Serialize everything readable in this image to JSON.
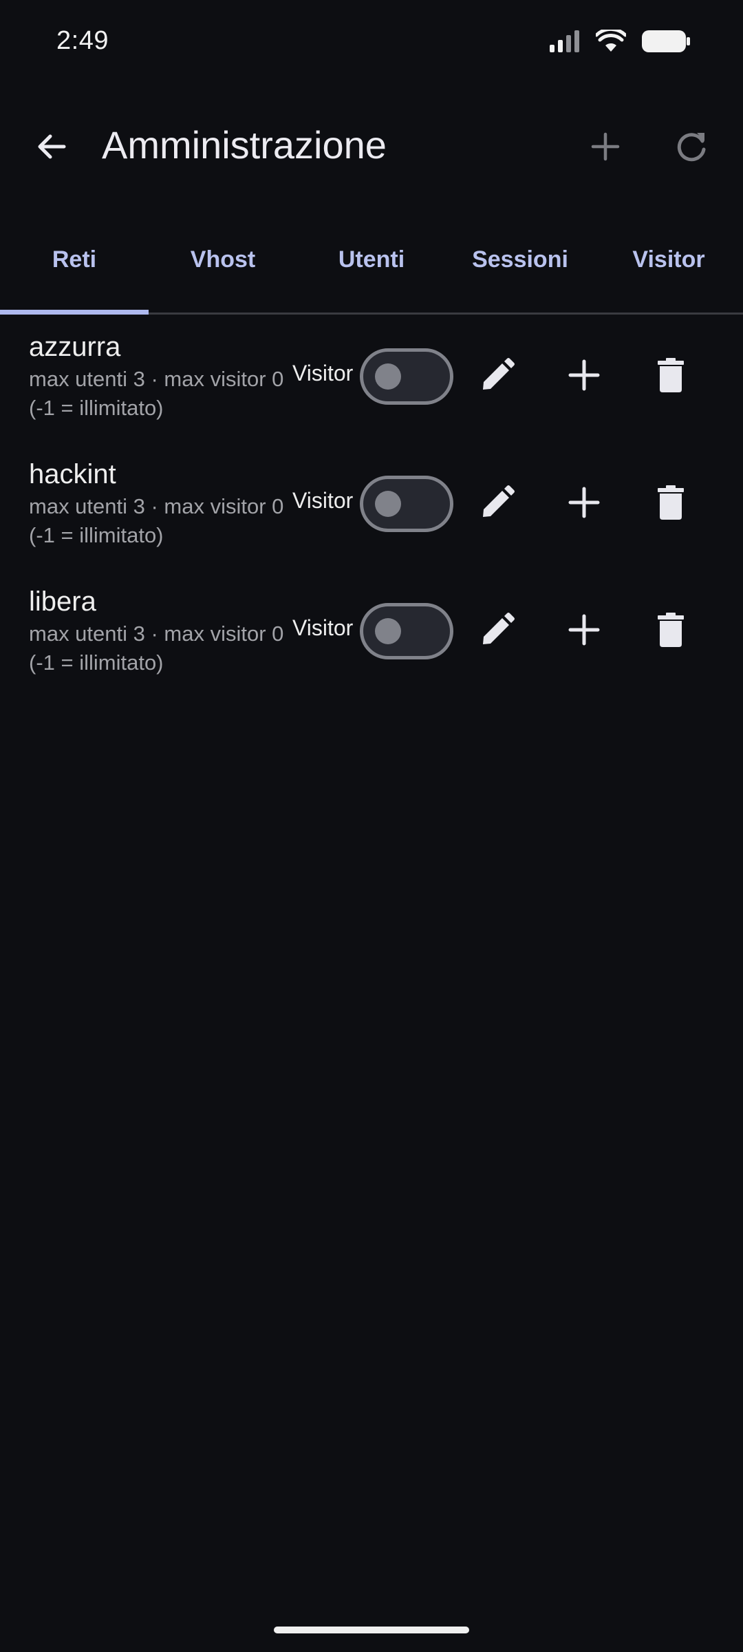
{
  "status_bar": {
    "time": "2:49",
    "icons": [
      "cellular-signal-icon",
      "wifi-icon",
      "battery-icon"
    ]
  },
  "app_bar": {
    "title": "Amministrazione",
    "back_icon": "arrow-left-icon",
    "actions": [
      "plus-icon",
      "refresh-icon"
    ]
  },
  "tabs": [
    {
      "label": "Reti",
      "active": true
    },
    {
      "label": "Vhost",
      "active": false
    },
    {
      "label": "Utenti",
      "active": false
    },
    {
      "label": "Sessioni",
      "active": false
    },
    {
      "label": "Visitor",
      "active": false
    }
  ],
  "networks": [
    {
      "name": "azzurra",
      "meta": "max utenti 3 · max visitor 0 (-1 = illimitato)",
      "visitor_label": "Visitor",
      "visitor_enabled": false
    },
    {
      "name": "hackint",
      "meta": "max utenti 3 · max visitor 0 (-1 = illimitato)",
      "visitor_label": "Visitor",
      "visitor_enabled": false
    },
    {
      "name": "libera",
      "meta": "max utenti 3 · max visitor 0 (-1 = illimitato)",
      "visitor_label": "Visitor",
      "visitor_enabled": false
    }
  ],
  "colors": {
    "background": "#0d0e12",
    "accent": "#b9c2ee",
    "text": "#eeeeee",
    "secondary_text": "#a2a3a8"
  }
}
